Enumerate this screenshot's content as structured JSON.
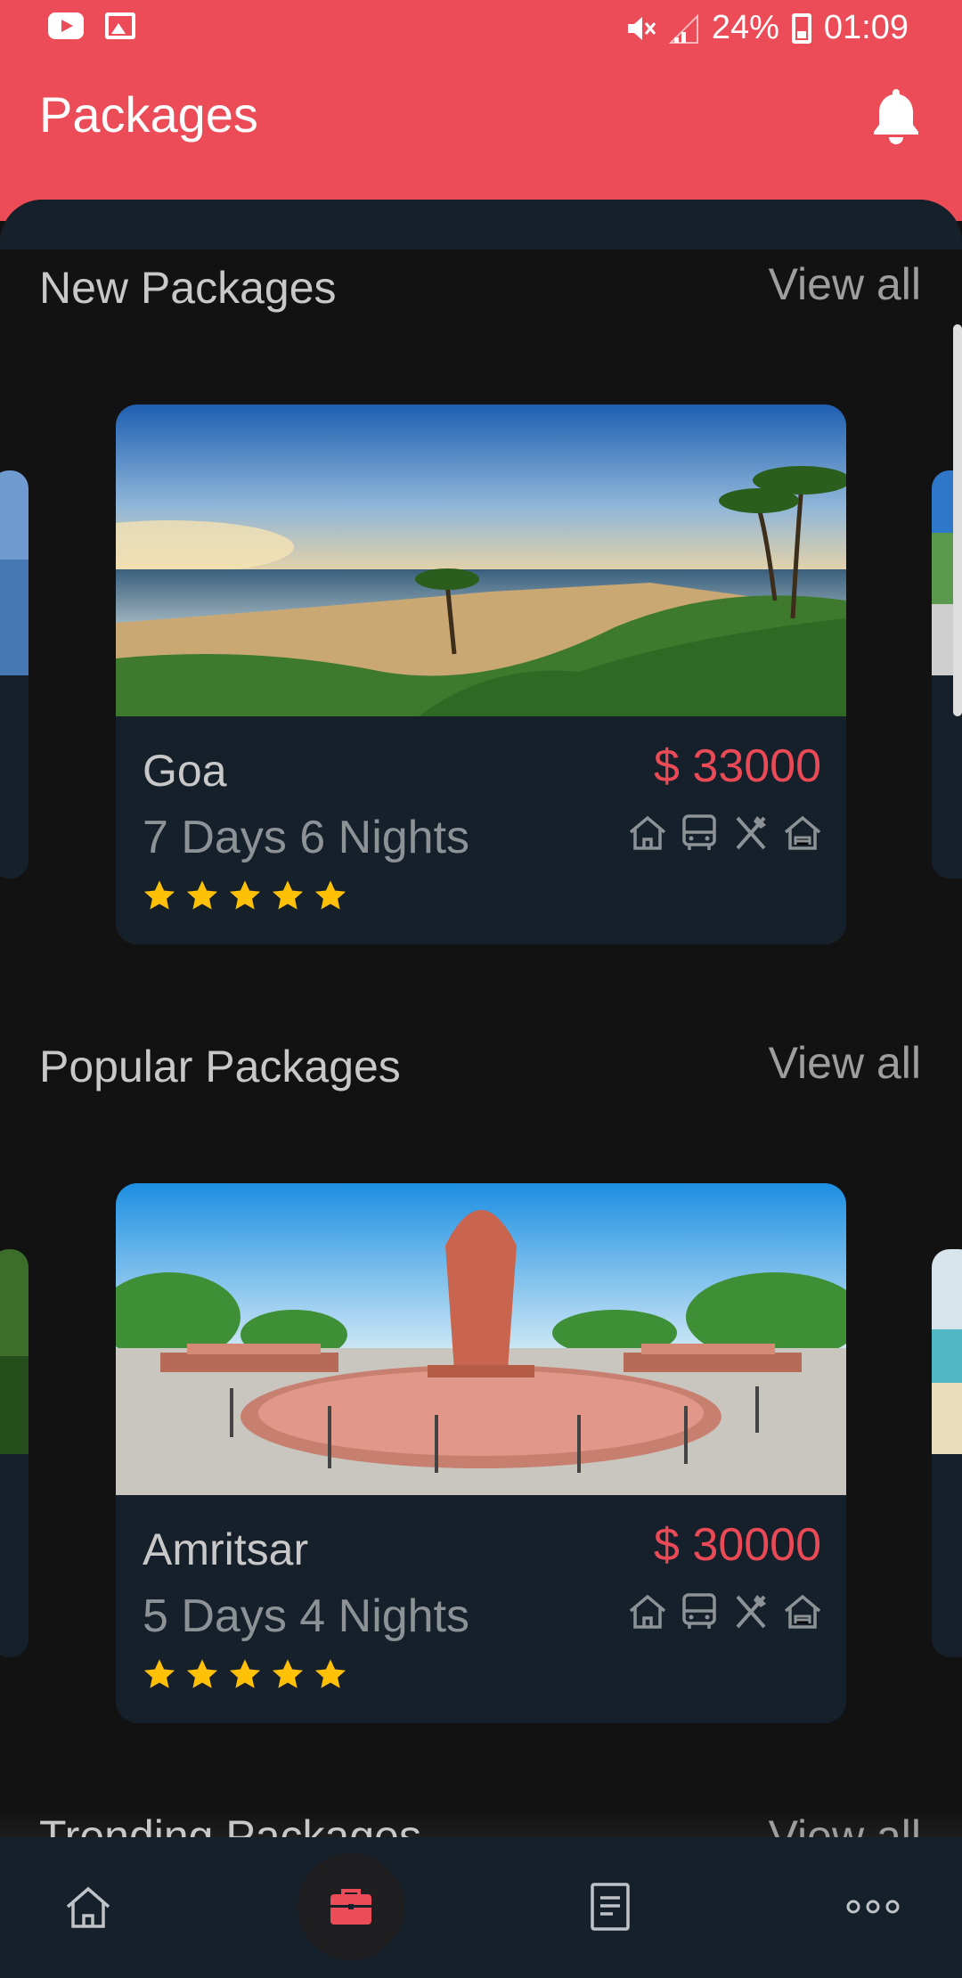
{
  "status_bar": {
    "battery": "24%",
    "time": "01:09"
  },
  "app_bar": {
    "title": "Packages"
  },
  "sections": [
    {
      "title": "New Packages",
      "view_all": "View all",
      "card": {
        "name": "Goa",
        "price": "$ 33000",
        "duration": "7 Days 6 Nights",
        "rating": 5,
        "amenities": [
          "home-icon",
          "bus-icon",
          "restaurant-icon",
          "hotel-icon"
        ]
      }
    },
    {
      "title": "Popular Packages",
      "view_all": "View all",
      "card": {
        "name": "Amritsar",
        "price": "$ 30000",
        "duration": "5 Days 4 Nights",
        "rating": 5,
        "amenities": [
          "home-icon",
          "bus-icon",
          "restaurant-icon",
          "hotel-icon"
        ]
      }
    },
    {
      "title": "Trending Packages",
      "view_all": "View all"
    }
  ],
  "bottom_nav": {
    "items": [
      "home-icon",
      "briefcase-icon",
      "document-icon",
      "more-icon"
    ],
    "active": "briefcase-icon"
  },
  "colors": {
    "accent": "#ec4c57",
    "price": "#e94a55",
    "star": "#ffc107",
    "card": "#15202b",
    "background": "#121212"
  }
}
